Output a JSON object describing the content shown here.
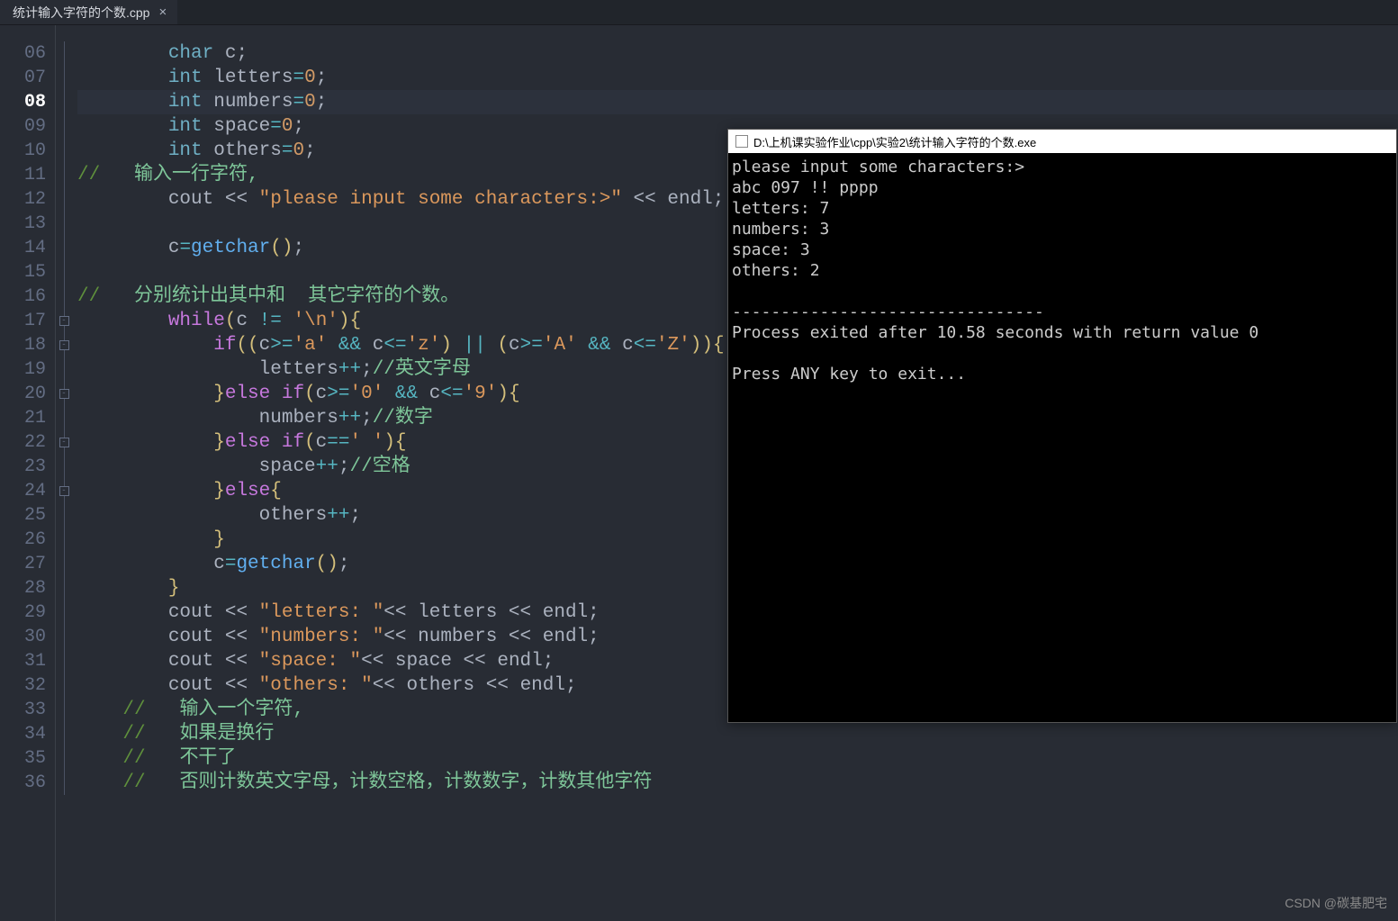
{
  "tab": {
    "title": "统计输入字符的个数.cpp",
    "close": "×"
  },
  "gutter": {
    "line_numbers": [
      "06",
      "07",
      "08",
      "09",
      "10",
      "11",
      "12",
      "13",
      "14",
      "15",
      "16",
      "17",
      "18",
      "19",
      "20",
      "21",
      "22",
      "23",
      "24",
      "25",
      "26",
      "27",
      "28",
      "29",
      "30",
      "31",
      "32",
      "33",
      "34",
      "35",
      "36"
    ],
    "current_line": "08"
  },
  "fold": {
    "markers": [
      null,
      null,
      null,
      null,
      null,
      null,
      null,
      null,
      null,
      null,
      null,
      "box",
      "box",
      null,
      "box",
      null,
      "box",
      null,
      "box",
      null,
      null,
      null,
      null,
      null,
      null,
      null,
      null,
      null,
      null,
      null,
      null
    ]
  },
  "code": {
    "lines": [
      {
        "indent": "        ",
        "segs": [
          {
            "t": "char",
            "c": "kw"
          },
          {
            "t": " ",
            "c": "plain"
          },
          {
            "t": "c",
            "c": "plain"
          },
          {
            "t": ";",
            "c": "plain"
          }
        ]
      },
      {
        "indent": "        ",
        "segs": [
          {
            "t": "int",
            "c": "kw"
          },
          {
            "t": " ",
            "c": "plain"
          },
          {
            "t": "letters",
            "c": "plain"
          },
          {
            "t": "=",
            "c": "op"
          },
          {
            "t": "0",
            "c": "num"
          },
          {
            "t": ";",
            "c": "plain"
          }
        ]
      },
      {
        "indent": "        ",
        "hl": true,
        "segs": [
          {
            "t": "int",
            "c": "kw"
          },
          {
            "t": " ",
            "c": "plain"
          },
          {
            "t": "numbers",
            "c": "plain"
          },
          {
            "t": "=",
            "c": "op"
          },
          {
            "t": "0",
            "c": "num"
          },
          {
            "t": ";",
            "c": "plain"
          }
        ]
      },
      {
        "indent": "        ",
        "segs": [
          {
            "t": "int",
            "c": "kw"
          },
          {
            "t": " ",
            "c": "plain"
          },
          {
            "t": "space",
            "c": "plain"
          },
          {
            "t": "=",
            "c": "op"
          },
          {
            "t": "0",
            "c": "num"
          },
          {
            "t": ";",
            "c": "plain"
          }
        ]
      },
      {
        "indent": "        ",
        "segs": [
          {
            "t": "int",
            "c": "kw"
          },
          {
            "t": " ",
            "c": "plain"
          },
          {
            "t": "others",
            "c": "plain"
          },
          {
            "t": "=",
            "c": "op"
          },
          {
            "t": "0",
            "c": "num"
          },
          {
            "t": ";",
            "c": "plain"
          }
        ]
      },
      {
        "indent": "",
        "segs": [
          {
            "t": "//   ",
            "c": "cmt2"
          },
          {
            "t": "输入一行字符,",
            "c": "cmt"
          }
        ]
      },
      {
        "indent": "        ",
        "segs": [
          {
            "t": "cout",
            "c": "plain"
          },
          {
            "t": " << ",
            "c": "plain"
          },
          {
            "t": "\"please input some characters:>\"",
            "c": "str"
          },
          {
            "t": " << ",
            "c": "plain"
          },
          {
            "t": "endl",
            "c": "plain"
          },
          {
            "t": ";",
            "c": "plain"
          }
        ]
      },
      {
        "indent": "",
        "segs": []
      },
      {
        "indent": "        ",
        "segs": [
          {
            "t": "c",
            "c": "plain"
          },
          {
            "t": "=",
            "c": "op"
          },
          {
            "t": "getchar",
            "c": "fn"
          },
          {
            "t": "()",
            "c": "punc"
          },
          {
            "t": ";",
            "c": "plain"
          }
        ]
      },
      {
        "indent": "",
        "segs": []
      },
      {
        "indent": "",
        "segs": [
          {
            "t": "//   ",
            "c": "cmt2"
          },
          {
            "t": "分别统计出其中和  其它字符的个数。",
            "c": "cmt"
          }
        ]
      },
      {
        "indent": "        ",
        "segs": [
          {
            "t": "while",
            "c": "typ"
          },
          {
            "t": "(",
            "c": "punc"
          },
          {
            "t": "c ",
            "c": "plain"
          },
          {
            "t": "!=",
            "c": "op"
          },
          {
            "t": " ",
            "c": "plain"
          },
          {
            "t": "'\\n'",
            "c": "str"
          },
          {
            "t": ")",
            "c": "punc"
          },
          {
            "t": "{",
            "c": "punc"
          }
        ]
      },
      {
        "indent": "            ",
        "segs": [
          {
            "t": "if",
            "c": "typ"
          },
          {
            "t": "((",
            "c": "punc"
          },
          {
            "t": "c",
            "c": "plain"
          },
          {
            "t": ">=",
            "c": "op"
          },
          {
            "t": "'a'",
            "c": "str"
          },
          {
            "t": " ",
            "c": "plain"
          },
          {
            "t": "&&",
            "c": "op"
          },
          {
            "t": " c",
            "c": "plain"
          },
          {
            "t": "<=",
            "c": "op"
          },
          {
            "t": "'z'",
            "c": "str"
          },
          {
            "t": ")",
            "c": "punc"
          },
          {
            "t": " ",
            "c": "plain"
          },
          {
            "t": "||",
            "c": "op"
          },
          {
            "t": " ",
            "c": "plain"
          },
          {
            "t": "(",
            "c": "punc"
          },
          {
            "t": "c",
            "c": "plain"
          },
          {
            "t": ">=",
            "c": "op"
          },
          {
            "t": "'A'",
            "c": "str"
          },
          {
            "t": " ",
            "c": "plain"
          },
          {
            "t": "&&",
            "c": "op"
          },
          {
            "t": " c",
            "c": "plain"
          },
          {
            "t": "<=",
            "c": "op"
          },
          {
            "t": "'Z'",
            "c": "str"
          },
          {
            "t": "))",
            "c": "punc"
          },
          {
            "t": "{",
            "c": "punc"
          }
        ]
      },
      {
        "indent": "                ",
        "segs": [
          {
            "t": "letters",
            "c": "plain"
          },
          {
            "t": "++",
            "c": "op"
          },
          {
            "t": ";",
            "c": "plain"
          },
          {
            "t": "//英文字母",
            "c": "cmt"
          }
        ]
      },
      {
        "indent": "            ",
        "segs": [
          {
            "t": "}",
            "c": "punc"
          },
          {
            "t": "else if",
            "c": "typ"
          },
          {
            "t": "(",
            "c": "punc"
          },
          {
            "t": "c",
            "c": "plain"
          },
          {
            "t": ">=",
            "c": "op"
          },
          {
            "t": "'0'",
            "c": "str"
          },
          {
            "t": " ",
            "c": "plain"
          },
          {
            "t": "&&",
            "c": "op"
          },
          {
            "t": " c",
            "c": "plain"
          },
          {
            "t": "<=",
            "c": "op"
          },
          {
            "t": "'9'",
            "c": "str"
          },
          {
            "t": ")",
            "c": "punc"
          },
          {
            "t": "{",
            "c": "punc"
          }
        ]
      },
      {
        "indent": "                ",
        "segs": [
          {
            "t": "numbers",
            "c": "plain"
          },
          {
            "t": "++",
            "c": "op"
          },
          {
            "t": ";",
            "c": "plain"
          },
          {
            "t": "//数字",
            "c": "cmt"
          }
        ]
      },
      {
        "indent": "            ",
        "segs": [
          {
            "t": "}",
            "c": "punc"
          },
          {
            "t": "else if",
            "c": "typ"
          },
          {
            "t": "(",
            "c": "punc"
          },
          {
            "t": "c",
            "c": "plain"
          },
          {
            "t": "==",
            "c": "op"
          },
          {
            "t": "' '",
            "c": "str"
          },
          {
            "t": ")",
            "c": "punc"
          },
          {
            "t": "{",
            "c": "punc"
          }
        ]
      },
      {
        "indent": "                ",
        "segs": [
          {
            "t": "space",
            "c": "plain"
          },
          {
            "t": "++",
            "c": "op"
          },
          {
            "t": ";",
            "c": "plain"
          },
          {
            "t": "//空格",
            "c": "cmt"
          }
        ]
      },
      {
        "indent": "            ",
        "segs": [
          {
            "t": "}",
            "c": "punc"
          },
          {
            "t": "else",
            "c": "typ"
          },
          {
            "t": "{",
            "c": "punc"
          }
        ]
      },
      {
        "indent": "                ",
        "segs": [
          {
            "t": "others",
            "c": "plain"
          },
          {
            "t": "++",
            "c": "op"
          },
          {
            "t": ";",
            "c": "plain"
          }
        ]
      },
      {
        "indent": "            ",
        "segs": [
          {
            "t": "}",
            "c": "punc"
          }
        ]
      },
      {
        "indent": "            ",
        "segs": [
          {
            "t": "c",
            "c": "plain"
          },
          {
            "t": "=",
            "c": "op"
          },
          {
            "t": "getchar",
            "c": "fn"
          },
          {
            "t": "()",
            "c": "punc"
          },
          {
            "t": ";",
            "c": "plain"
          }
        ]
      },
      {
        "indent": "        ",
        "segs": [
          {
            "t": "}",
            "c": "punc"
          }
        ]
      },
      {
        "indent": "        ",
        "segs": [
          {
            "t": "cout",
            "c": "plain"
          },
          {
            "t": " << ",
            "c": "plain"
          },
          {
            "t": "\"letters: \"",
            "c": "str"
          },
          {
            "t": "<< ",
            "c": "plain"
          },
          {
            "t": "letters",
            "c": "plain"
          },
          {
            "t": " << ",
            "c": "plain"
          },
          {
            "t": "endl",
            "c": "plain"
          },
          {
            "t": ";",
            "c": "plain"
          }
        ]
      },
      {
        "indent": "        ",
        "segs": [
          {
            "t": "cout",
            "c": "plain"
          },
          {
            "t": " << ",
            "c": "plain"
          },
          {
            "t": "\"numbers: \"",
            "c": "str"
          },
          {
            "t": "<< ",
            "c": "plain"
          },
          {
            "t": "numbers",
            "c": "plain"
          },
          {
            "t": " << ",
            "c": "plain"
          },
          {
            "t": "endl",
            "c": "plain"
          },
          {
            "t": ";",
            "c": "plain"
          }
        ]
      },
      {
        "indent": "        ",
        "segs": [
          {
            "t": "cout",
            "c": "plain"
          },
          {
            "t": " << ",
            "c": "plain"
          },
          {
            "t": "\"space: \"",
            "c": "str"
          },
          {
            "t": "<< ",
            "c": "plain"
          },
          {
            "t": "space",
            "c": "plain"
          },
          {
            "t": " << ",
            "c": "plain"
          },
          {
            "t": "endl",
            "c": "plain"
          },
          {
            "t": ";",
            "c": "plain"
          }
        ]
      },
      {
        "indent": "        ",
        "segs": [
          {
            "t": "cout",
            "c": "plain"
          },
          {
            "t": " << ",
            "c": "plain"
          },
          {
            "t": "\"others: \"",
            "c": "str"
          },
          {
            "t": "<< ",
            "c": "plain"
          },
          {
            "t": "others",
            "c": "plain"
          },
          {
            "t": " << ",
            "c": "plain"
          },
          {
            "t": "endl",
            "c": "plain"
          },
          {
            "t": ";",
            "c": "plain"
          }
        ]
      },
      {
        "indent": "    ",
        "segs": [
          {
            "t": "//   ",
            "c": "cmt2"
          },
          {
            "t": "输入一个字符,",
            "c": "cmt"
          }
        ]
      },
      {
        "indent": "    ",
        "segs": [
          {
            "t": "//   ",
            "c": "cmt2"
          },
          {
            "t": "如果是换行",
            "c": "cmt"
          }
        ]
      },
      {
        "indent": "    ",
        "segs": [
          {
            "t": "//   ",
            "c": "cmt2"
          },
          {
            "t": "不干了",
            "c": "cmt"
          }
        ]
      },
      {
        "indent": "    ",
        "segs": [
          {
            "t": "//   ",
            "c": "cmt2"
          },
          {
            "t": "否则计数英文字母，计数空格，计数数字，计数其他字符",
            "c": "cmt"
          }
        ]
      }
    ]
  },
  "console": {
    "title": "D:\\上机课实验作业\\cpp\\实验2\\统计输入字符的个数.exe",
    "output": "please input some characters:>\nabc 097 !! pppp\nletters: 7\nnumbers: 3\nspace: 3\nothers: 2\n\n--------------------------------\nProcess exited after 10.58 seconds with return value 0\n\nPress ANY key to exit..."
  },
  "watermark": "CSDN @碳基肥宅"
}
